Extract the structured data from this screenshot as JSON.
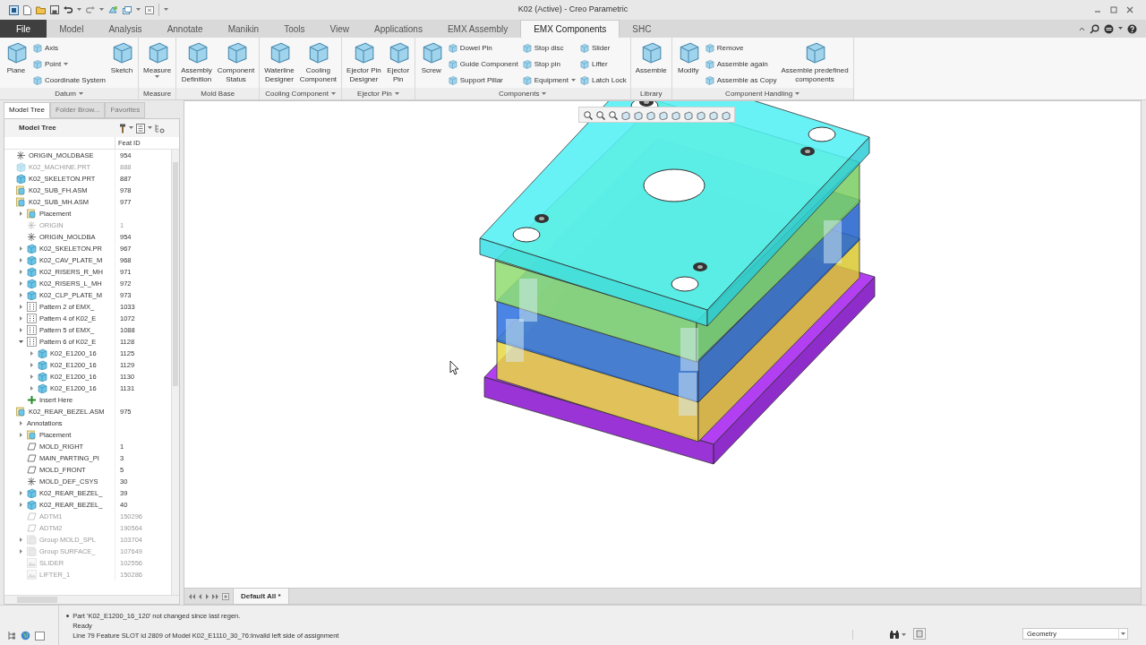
{
  "window": {
    "title": "K02 (Active) - Creo Parametric"
  },
  "ribbon_tabs": [
    {
      "label": "File",
      "kind": "file",
      "selected": false
    },
    {
      "label": "Model",
      "kind": "tab",
      "selected": false
    },
    {
      "label": "Analysis",
      "kind": "tab",
      "selected": false
    },
    {
      "label": "Annotate",
      "kind": "tab",
      "selected": false
    },
    {
      "label": "Manikin",
      "kind": "tab",
      "selected": false
    },
    {
      "label": "Tools",
      "kind": "tab",
      "selected": false
    },
    {
      "label": "View",
      "kind": "tab",
      "selected": false
    },
    {
      "label": "Applications",
      "kind": "tab",
      "selected": false
    },
    {
      "label": "EMX Assembly",
      "kind": "tab",
      "selected": false
    },
    {
      "label": "EMX Components",
      "kind": "tab",
      "selected": true
    },
    {
      "label": "SHC",
      "kind": "tab",
      "selected": false
    }
  ],
  "ribbon_groups": [
    {
      "label": "Datum",
      "menu": true,
      "items": [
        {
          "kind": "large",
          "lines": [
            "Plane"
          ]
        },
        {
          "kind": "small",
          "lines": [
            "Axis"
          ]
        },
        {
          "kind": "small",
          "lines": [
            "Point"
          ],
          "menu": true
        },
        {
          "kind": "small",
          "lines": [
            "Coordinate System"
          ]
        },
        {
          "kind": "large",
          "lines": [
            "Sketch"
          ]
        }
      ]
    },
    {
      "label": "Measure",
      "items": [
        {
          "kind": "large",
          "lines": [
            "Measure"
          ],
          "menu": true
        }
      ]
    },
    {
      "label": "Mold Base",
      "items": [
        {
          "kind": "large",
          "lines": [
            "Assembly",
            "Definition"
          ]
        },
        {
          "kind": "large",
          "lines": [
            "Component",
            "Status"
          ]
        }
      ]
    },
    {
      "label": "Cooling Component",
      "menu": true,
      "items": [
        {
          "kind": "large",
          "lines": [
            "Waterline",
            "Designer"
          ]
        },
        {
          "kind": "large",
          "lines": [
            "Cooling",
            "Component"
          ]
        }
      ]
    },
    {
      "label": "Ejector Pin",
      "menu": true,
      "items": [
        {
          "kind": "large",
          "lines": [
            "Ejector Pin",
            "Designer"
          ]
        },
        {
          "kind": "large",
          "lines": [
            "Ejector",
            "Pin"
          ]
        }
      ]
    },
    {
      "label": "Components",
      "menu": true,
      "items": [
        {
          "kind": "large",
          "lines": [
            "Screw"
          ]
        },
        {
          "kind": "small",
          "lines": [
            "Dowel Pin"
          ]
        },
        {
          "kind": "small",
          "lines": [
            "Guide Component"
          ]
        },
        {
          "kind": "small",
          "lines": [
            "Support Pillar"
          ]
        },
        {
          "kind": "small",
          "lines": [
            "Stop disc"
          ]
        },
        {
          "kind": "small",
          "lines": [
            "Stop pin"
          ]
        },
        {
          "kind": "small",
          "lines": [
            "Equipment"
          ],
          "menu": true
        },
        {
          "kind": "small",
          "lines": [
            "Slider"
          ]
        },
        {
          "kind": "small",
          "lines": [
            "Lifter"
          ]
        },
        {
          "kind": "small",
          "lines": [
            "Latch Lock"
          ]
        }
      ]
    },
    {
      "label": "Library",
      "items": [
        {
          "kind": "large",
          "lines": [
            "Assemble"
          ]
        }
      ]
    },
    {
      "label": "Component Handling",
      "menu": true,
      "items": [
        {
          "kind": "large",
          "lines": [
            "Modify"
          ]
        },
        {
          "kind": "small",
          "lines": [
            "Remove"
          ]
        },
        {
          "kind": "small",
          "lines": [
            "Assemble again"
          ]
        },
        {
          "kind": "small",
          "lines": [
            "Assemble as Copy"
          ]
        },
        {
          "kind": "large",
          "lines": [
            "Assemble predefined",
            "components"
          ]
        }
      ]
    }
  ],
  "navigator_tabs": [
    {
      "label": "Model Tree",
      "selected": true
    },
    {
      "label": "Folder Brow...",
      "selected": false
    },
    {
      "label": "Favorites",
      "selected": false
    }
  ],
  "model_tree": {
    "title": "Model Tree",
    "column_2": "Feat ID",
    "items": [
      {
        "name": "ORIGIN_MOLDBASE",
        "feat_id": "954",
        "kind": "csys",
        "dimmed": false
      },
      {
        "name": "K02_MACHINE.PRT",
        "feat_id": "888",
        "kind": "part",
        "dimmed": true
      },
      {
        "name": "K02_SKELETON.PRT",
        "feat_id": "887",
        "kind": "part",
        "dimmed": false
      },
      {
        "name": "K02_SUB_FH.ASM",
        "feat_id": "978",
        "kind": "asm",
        "dimmed": false
      },
      {
        "name": "K02_SUB_MH.ASM",
        "feat_id": "977",
        "kind": "asm",
        "dimmed": false,
        "children": [
          {
            "name": "Placement",
            "kind": "asm",
            "dimmed": false,
            "expanded": false
          },
          {
            "name": "ORIGIN",
            "feat_id": "1",
            "kind": "csys",
            "dimmed": true
          },
          {
            "name": "ORIGIN_MOLDBA",
            "feat_id": "954",
            "kind": "csys",
            "dimmed": false
          },
          {
            "name": "K02_SKELETON.PR",
            "feat_id": "967",
            "kind": "part",
            "dimmed": false,
            "expanded": false
          },
          {
            "name": "K02_CAV_PLATE_M",
            "feat_id": "968",
            "kind": "part",
            "dimmed": false,
            "expanded": false
          },
          {
            "name": "K02_RISERS_R_MH",
            "feat_id": "971",
            "kind": "part",
            "dimmed": false,
            "expanded": false
          },
          {
            "name": "K02_RISERS_L_MH",
            "feat_id": "972",
            "kind": "part",
            "dimmed": false,
            "expanded": false
          },
          {
            "name": "K02_CLP_PLATE_M",
            "feat_id": "973",
            "kind": "part",
            "dimmed": false,
            "expanded": false
          },
          {
            "name": "Pattern 2 of EMX_",
            "feat_id": "1033",
            "kind": "pattern",
            "dimmed": false,
            "expanded": false
          },
          {
            "name": "Pattern 4 of K02_E",
            "feat_id": "1072",
            "kind": "pattern",
            "dimmed": false,
            "expanded": false
          },
          {
            "name": "Pattern 5 of EMX_",
            "feat_id": "1088",
            "kind": "pattern",
            "dimmed": false,
            "expanded": false
          },
          {
            "name": "Pattern 6 of K02_E",
            "feat_id": "1128",
            "kind": "pattern",
            "dimmed": false,
            "expanded": true,
            "children": [
              {
                "name": "K02_E1200_16",
                "feat_id": "1125",
                "kind": "part",
                "dimmed": false,
                "expanded": false
              },
              {
                "name": "K02_E1200_16",
                "feat_id": "1129",
                "kind": "part",
                "dimmed": false,
                "expanded": false
              },
              {
                "name": "K02_E1200_16",
                "feat_id": "1130",
                "kind": "part",
                "dimmed": false,
                "expanded": false
              },
              {
                "name": "K02_E1200_16",
                "feat_id": "1131",
                "kind": "part",
                "dimmed": false,
                "expanded": false
              }
            ]
          },
          {
            "name": "Insert Here",
            "kind": "insert",
            "dimmed": false
          }
        ]
      },
      {
        "name": "K02_REAR_BEZEL.ASM",
        "feat_id": "975",
        "kind": "asm",
        "dimmed": false,
        "children": [
          {
            "name": "Annotations",
            "kind": "none",
            "dimmed": false,
            "expanded": false
          },
          {
            "name": "Placement",
            "kind": "asm",
            "dimmed": false,
            "expanded": false
          },
          {
            "name": "MOLD_RIGHT",
            "feat_id": "1",
            "kind": "plane",
            "dimmed": false
          },
          {
            "name": "MAIN_PARTING_PI",
            "feat_id": "3",
            "kind": "plane",
            "dimmed": false
          },
          {
            "name": "MOLD_FRONT",
            "feat_id": "5",
            "kind": "plane",
            "dimmed": false
          },
          {
            "name": "MOLD_DEF_CSYS",
            "feat_id": "30",
            "kind": "csys",
            "dimmed": false
          },
          {
            "name": "K02_REAR_BEZEL_",
            "feat_id": "39",
            "kind": "part",
            "dimmed": false,
            "expanded": false
          },
          {
            "name": "K02_REAR_BEZEL_",
            "feat_id": "40",
            "kind": "part",
            "dimmed": false,
            "expanded": false
          },
          {
            "name": "ADTM1",
            "feat_id": "150296",
            "kind": "plane",
            "dimmed": true
          },
          {
            "name": "ADTM2",
            "feat_id": "190564",
            "kind": "plane",
            "dimmed": true
          },
          {
            "name": "Group MOLD_SPL",
            "feat_id": "103704",
            "kind": "group",
            "dimmed": true,
            "expanded": false
          },
          {
            "name": "Group SURFACE_",
            "feat_id": "107649",
            "kind": "group",
            "dimmed": true,
            "expanded": false
          },
          {
            "name": "SLIDER",
            "feat_id": "102556",
            "kind": "surface",
            "dimmed": true
          },
          {
            "name": "LIFTER_1",
            "feat_id": "150286",
            "kind": "surface",
            "dimmed": true
          }
        ]
      }
    ]
  },
  "graphics_tabs": [
    {
      "label": "Default All *",
      "selected": true
    }
  ],
  "messages": [
    {
      "kind": "bullet",
      "text": "Part 'K02_E1200_16_120' not changed since last regen."
    },
    {
      "kind": "plain",
      "text": "Ready"
    },
    {
      "kind": "plain",
      "text": "Line 79 Feature SLOT id 2809 of Model K02_E1110_30_76:Invalid left side of assignment"
    }
  ],
  "filter": {
    "value": "Geometry"
  }
}
